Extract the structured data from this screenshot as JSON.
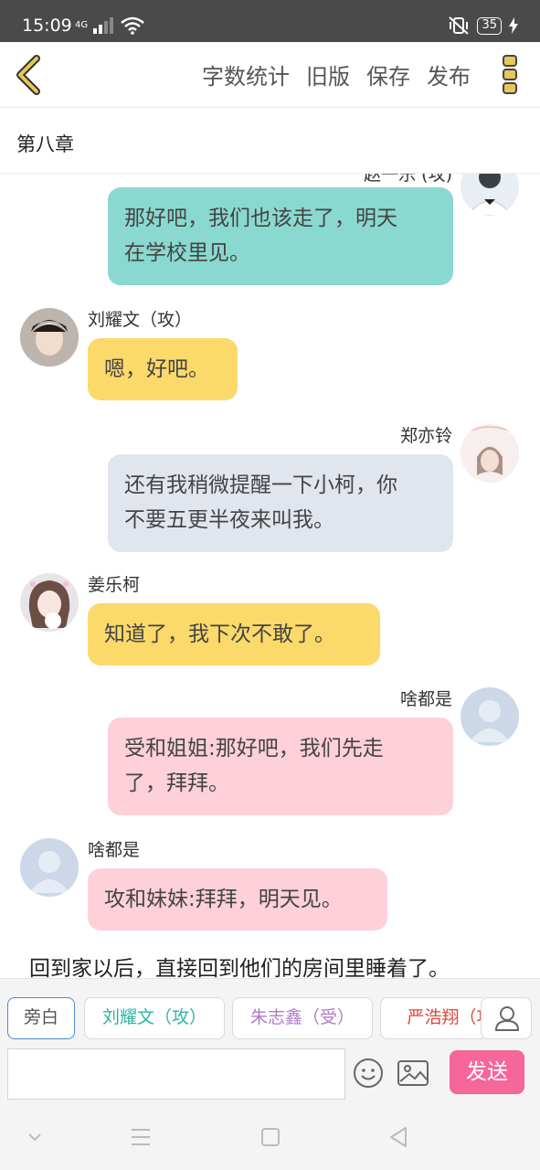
{
  "status_bar": {
    "time": "15:09",
    "network": "4G",
    "battery": "35"
  },
  "toolbar": {
    "actions": [
      "字数统计",
      "旧版",
      "保存",
      "发布"
    ],
    "accent": "#c9a227"
  },
  "chapter": {
    "title": "第八章"
  },
  "messages": [
    {
      "side": "right",
      "name": "赵一乐 (攻)",
      "text_lines": [
        "那好吧，我们也该走了，明天",
        "在学校里见。"
      ],
      "color": "#8ad9d0",
      "avatar": "avatar-photo-icon"
    },
    {
      "side": "left",
      "name": "刘耀文（攻）",
      "text_lines": [
        "嗯，好吧。"
      ],
      "color": "#fbd96b",
      "avatar": "avatar-photo-icon"
    },
    {
      "side": "right",
      "name": "郑亦铃",
      "text_lines": [
        "还有我稍微提醒一下小柯，你",
        "不要五更半夜来叫我。"
      ],
      "color": "#e1e6ee",
      "avatar": "avatar-photo-icon"
    },
    {
      "side": "left",
      "name": "姜乐柯",
      "text_lines": [
        "知道了，我下次不敢了。"
      ],
      "color": "#fbd96b",
      "avatar": "avatar-photo-icon"
    },
    {
      "side": "right",
      "name": "啥都是",
      "text_lines": [
        "受和姐姐:那好吧，我们先走",
        "了，拜拜。"
      ],
      "color": "#fdd0da",
      "avatar": "default-avatar-icon"
    },
    {
      "side": "left",
      "name": "啥都是",
      "text_lines": [
        "攻和妹妹:拜拜，明天见。"
      ],
      "color": "#fdd0da",
      "avatar": "default-avatar-icon"
    }
  ],
  "narration": "回到家以后，直接回到他们的房间里睡着了。",
  "role_tabs": [
    {
      "label": "旁白",
      "color": "#555555",
      "active": true
    },
    {
      "label": "刘耀文（攻）",
      "color": "#2fb3a6",
      "active": false
    },
    {
      "label": "朱志鑫（受）",
      "color": "#b07cc6",
      "active": false
    },
    {
      "label": "严浩翔（攻",
      "color": "#e0463c",
      "active": false
    }
  ],
  "input": {
    "value": "",
    "placeholder": ""
  },
  "send_label": "发送"
}
